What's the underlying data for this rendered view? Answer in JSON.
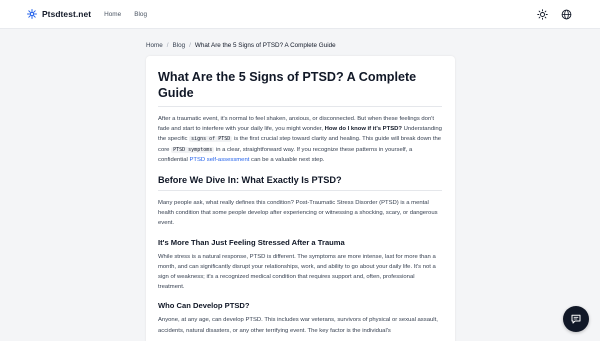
{
  "header": {
    "brand": "Ptsdtest.net",
    "nav": [
      "Home",
      "Blog"
    ],
    "icons": [
      "sun-icon",
      "globe-icon"
    ]
  },
  "breadcrumb": {
    "home": "Home",
    "blog": "Blog",
    "current": "What Are the 5 Signs of PTSD? A Complete Guide"
  },
  "article": {
    "title": "What Are the 5 Signs of PTSD? A Complete Guide",
    "intro": {
      "t1": "After a traumatic event, it's normal to feel shaken, anxious, or disconnected. But when these feelings don't fade and start to interfere with your daily life, you might wonder, ",
      "bold": "How do I know if it's PTSD?",
      "t2": " Understanding the specific ",
      "code1": "signs of PTSD",
      "t3": " is the first crucial step toward clarity and healing. This guide will break down the core ",
      "code2": "PTSD symptoms",
      "t4": " in a clear, straightforward way. If you recognize these patterns in yourself, a confidential ",
      "link": "PTSD self-assessment",
      "t5": " can be a valuable next step."
    },
    "h2_dive": "Before We Dive In: What Exactly Is PTSD?",
    "p_dive": "Many people ask, what really defines this condition? Post-Traumatic Stress Disorder (PTSD) is a mental health condition that some people develop after experiencing or witnessing a shocking, scary, or dangerous event.",
    "h3_stress": "It's More Than Just Feeling Stressed After a Trauma",
    "p_stress": "While stress is a natural response, PTSD is different. The symptoms are more intense, last for more than a month, and can significantly disrupt your relationships, work, and ability to go about your daily life. It's not a sign of weakness; it's a recognized medical condition that requires support and, often, professional treatment.",
    "h3_who": "Who Can Develop PTSD?",
    "p_who": "Anyone, at any age, can develop PTSD. This includes war veterans, survivors of physical or sexual assault, accidents, natural disasters, or any other terrifying event. The key factor is the individual's"
  },
  "colors": {
    "accent_link": "#2563eb",
    "chat_button": "#111827",
    "background": "#f4f5f7"
  }
}
